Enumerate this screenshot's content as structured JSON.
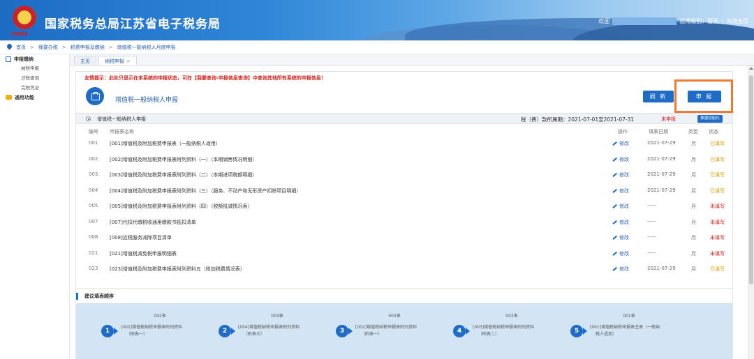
{
  "header": {
    "emblem_text": "中国税务",
    "site_title": "国家税务总局江苏省电子税务局",
    "welcome": "欢迎",
    "credit_label": "信用级别：暂无",
    "separator": "|",
    "close_page": "关闭当页"
  },
  "breadcrumb": [
    "首页",
    "我要办税",
    "税费申报及缴纳",
    "增值税一般纳税人月度申报"
  ],
  "breadcrumb_sep": ">",
  "sidebar": {
    "groups": [
      {
        "label": "申报缴纳",
        "items": [
          "纳税申报",
          "涉税查询",
          "完税凭证"
        ]
      },
      {
        "label": "通用功能",
        "items": []
      }
    ]
  },
  "tabs": [
    {
      "label": "主页"
    },
    {
      "label": "纳税申报",
      "close": "×"
    }
  ],
  "notice": "友情提示：此处只显示在本系统的申报状态，可在【我要查询-申报信息查询】中查询其他所有系统的申报信息！",
  "form": {
    "title": "增值税一般纳税人申报",
    "refresh_button": "刷 新",
    "declare_button": "申 报",
    "sub_name": "增值税一般纳税人申报",
    "period": "税（费）款所属期：2021-07-01至2021-07-31",
    "status": "未申报",
    "init_button": "数据初始化"
  },
  "table": {
    "headers": {
      "no": "编号",
      "name": "申报表名称",
      "op": "操作",
      "date": "填表日期",
      "type": "类型",
      "status": "状态"
    },
    "rows": [
      {
        "no": "001",
        "name": "[001]增值税及附加税费申报表（一般纳税人适用）",
        "op": "修改",
        "date": "2021-07-29",
        "type": "月",
        "status": "已填写",
        "done": true
      },
      {
        "no": "002",
        "name": "[002]增值税及附加税费申报表附列资料（一）（本期销售情况明细）",
        "op": "修改",
        "date": "2021-07-29",
        "type": "月",
        "status": "已填写",
        "done": true
      },
      {
        "no": "003",
        "name": "[003]增值税及附加税费申报表附列资料（二）（本期进项税额明细）",
        "op": "修改",
        "date": "2021-07-29",
        "type": "月",
        "status": "已填写",
        "done": true
      },
      {
        "no": "004",
        "name": "[004]增值税及附加税费申报表附列资料（三）（服务、不动产和无形资产扣除项目明细）",
        "op": "修改",
        "date": "2021-07-29",
        "type": "月",
        "status": "已填写",
        "done": true
      },
      {
        "no": "005",
        "name": "[005]增值税及附加税费申报表附列资料（四）（税额抵减情况表）",
        "op": "修改",
        "date": "-----",
        "type": "月",
        "status": "未填写",
        "done": false
      },
      {
        "no": "007",
        "name": "[007]代扣代缴税收通用缴款书抵扣清单",
        "op": "修改",
        "date": "-----",
        "type": "月",
        "status": "未填写",
        "done": false
      },
      {
        "no": "008",
        "name": "[008]应税服务减除项目清单",
        "op": "修改",
        "date": "-----",
        "type": "月",
        "status": "未填写",
        "done": false
      },
      {
        "no": "021",
        "name": "[021]增值税减免税申报明细表",
        "op": "修改",
        "date": "-----",
        "type": "月",
        "status": "未填写",
        "done": false
      },
      {
        "no": "023",
        "name": "[023]增值税及附加税费申报表附列资料五（附加税费情况表）",
        "op": "修改",
        "date": "2021-07-29",
        "type": "月",
        "status": "已填写",
        "done": true
      }
    ]
  },
  "order": {
    "title": "建议填表顺序",
    "steps": [
      {
        "num": "1",
        "top": "002表",
        "line1": "[002]增值税纳税申报表附列资料",
        "line2": "（附表一）"
      },
      {
        "num": "2",
        "top": "004表",
        "line1": "[004]增值税纳税申报表附列资料",
        "line2": "（附表三）"
      },
      {
        "num": "3",
        "top": "002表",
        "line1": "[002]增值税纳税申报表附列资料",
        "line2": "（附表一）"
      },
      {
        "num": "4",
        "top": "003表",
        "line1": "[003]增值税纳税申报表附列资料",
        "line2": "（附表二）"
      },
      {
        "num": "5",
        "top": "001表",
        "line1": "[001]增值税纳税申报表主表（一般纳",
        "line2": "税人适用）"
      }
    ]
  }
}
